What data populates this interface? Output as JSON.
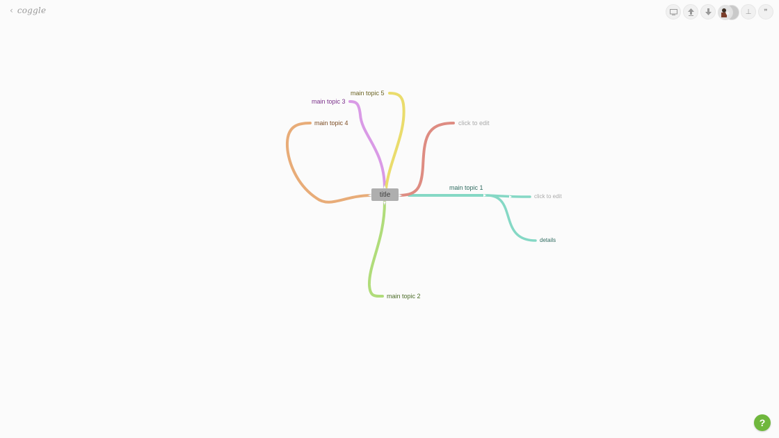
{
  "app": {
    "brand": "coggle",
    "back_glyph": "‹"
  },
  "toolbar": {
    "buttons": [
      {
        "name": "present-icon"
      },
      {
        "name": "upload-icon"
      },
      {
        "name": "download-icon"
      },
      {
        "name": "history-icon",
        "label": "⊥"
      },
      {
        "name": "quote-icon",
        "label": "❞"
      }
    ]
  },
  "map": {
    "root": {
      "label": "title"
    },
    "branches": [
      {
        "id": "topic1",
        "label": "main topic 1",
        "color": "#85d8c5",
        "text_color": "#2f6b60"
      },
      {
        "id": "topic1a",
        "label": "click to edit",
        "color": "#85d8c5",
        "text_color": "#aaaaaa"
      },
      {
        "id": "topic1b",
        "label": "details",
        "color": "#85d8c5",
        "text_color": "#2f6b60"
      },
      {
        "id": "topic2",
        "label": "main topic 2",
        "color": "#b0dc7a",
        "text_color": "#4a6b26"
      },
      {
        "id": "topic3",
        "label": "main topic 3",
        "color": "#d99ae6",
        "text_color": "#7a2f8a"
      },
      {
        "id": "topic4",
        "label": "main topic 4",
        "color": "#e8ac78",
        "text_color": "#7d4c22"
      },
      {
        "id": "topic5",
        "label": "main topic 5",
        "color": "#eadc6c",
        "text_color": "#6b6322"
      },
      {
        "id": "topic6",
        "label": "click to edit",
        "color": "#de8c82",
        "text_color": "#aaaaaa"
      }
    ]
  },
  "help": {
    "label": "?"
  }
}
